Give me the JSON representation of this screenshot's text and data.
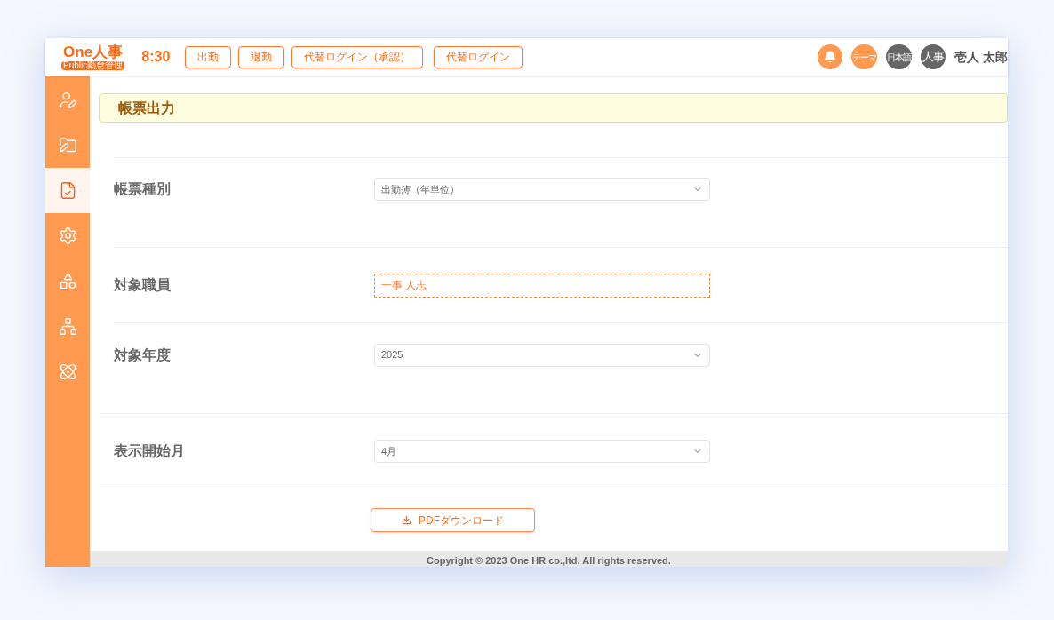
{
  "header": {
    "logo": {
      "title": "One人事",
      "subtitle": "Public勤怠管理"
    },
    "time": "8:30",
    "buttons": [
      "出勤",
      "退勤",
      "代替ログイン（承認）",
      "代替ログイン"
    ],
    "badges": [
      {
        "kind": "bell",
        "color": "#ff9a50"
      },
      {
        "kind": "text",
        "label": "テーマ",
        "color": "#ff9a50"
      },
      {
        "kind": "text",
        "label": "日本語",
        "color": "#666666"
      },
      {
        "kind": "text",
        "label": "人事",
        "color": "#666666"
      }
    ],
    "user": "壱人 太郎"
  },
  "sidebar": {
    "items": [
      {
        "selected": false
      },
      {
        "selected": false
      },
      {
        "selected": true
      },
      {
        "selected": false
      },
      {
        "selected": false
      },
      {
        "selected": false
      },
      {
        "selected": false
      }
    ]
  },
  "page_title": "帳票出力",
  "form": [
    {
      "label": "帳票種別",
      "kind": "select",
      "value": "出勤簿（年単位）"
    },
    {
      "label": "対象職員",
      "kind": "picker",
      "value": "一事 人志"
    },
    {
      "label": "対象年度",
      "kind": "select",
      "value": "2025"
    },
    {
      "label": "表示開始月",
      "kind": "select",
      "value": "4月"
    }
  ],
  "download_button": "PDFダウンロード",
  "footer": "Copyright © 2023 One HR co.,ltd. All rights reserved."
}
